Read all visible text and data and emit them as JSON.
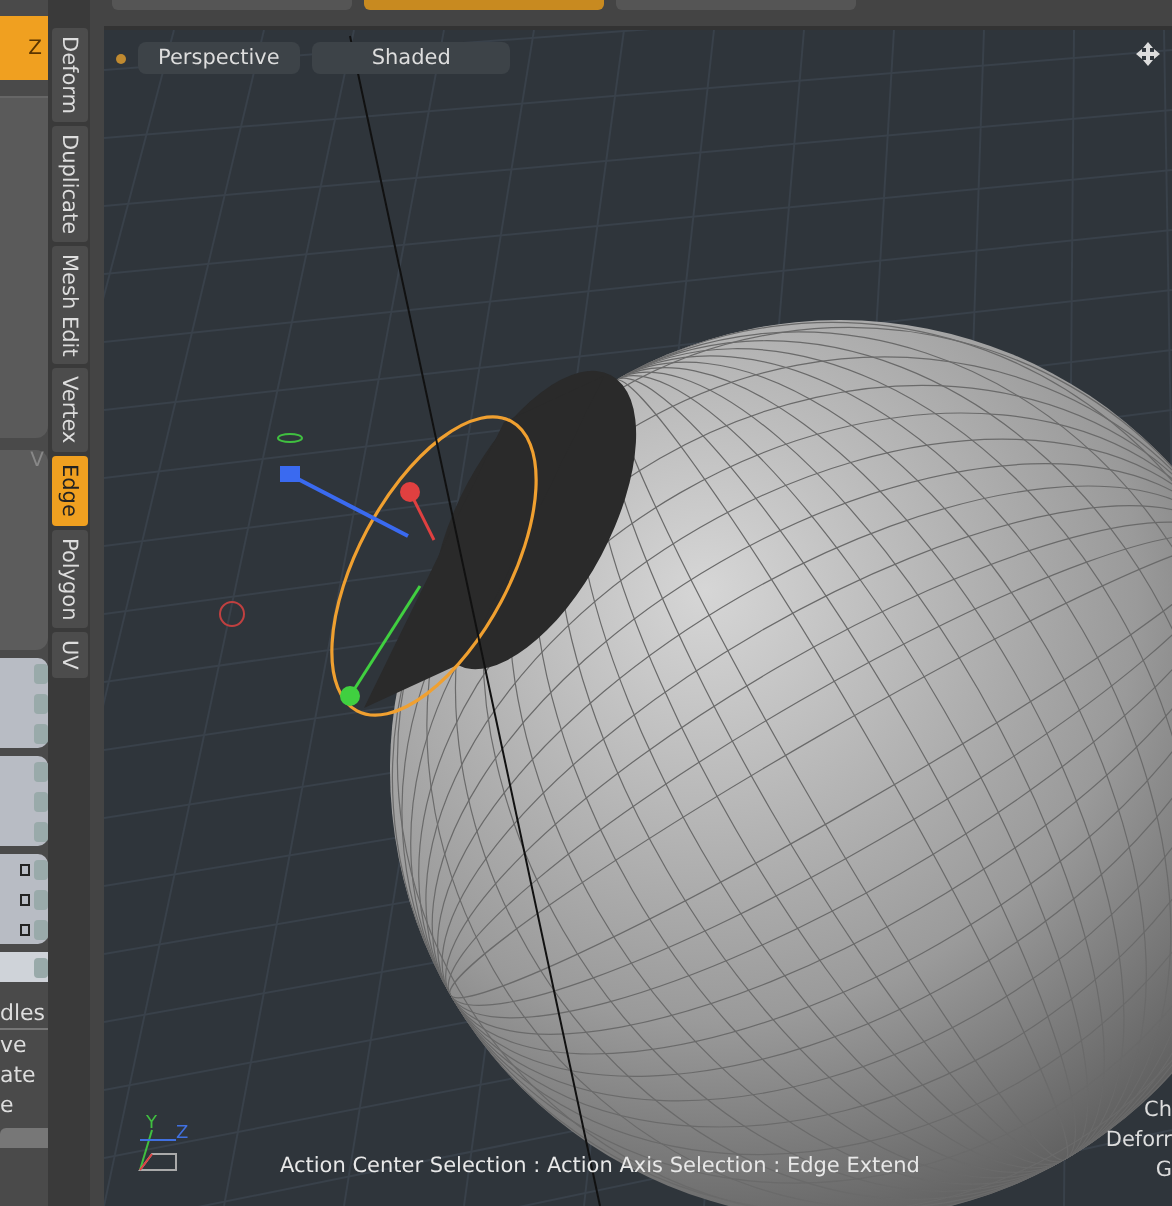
{
  "left_panel": {
    "axis_button": {
      "label": "Z",
      "selected": true
    },
    "field_label": "V",
    "spinner_groups": [
      {
        "rows": [
          {
            "kind": "plain"
          },
          {
            "kind": "plain"
          },
          {
            "kind": "plain"
          }
        ]
      },
      {
        "rows": [
          {
            "kind": "plain"
          },
          {
            "kind": "plain"
          },
          {
            "kind": "plain"
          }
        ]
      },
      {
        "rows": [
          {
            "kind": "keyed"
          },
          {
            "kind": "keyed"
          },
          {
            "kind": "keyed"
          }
        ]
      },
      {
        "rows": [
          {
            "kind": "slider"
          }
        ]
      }
    ],
    "section_title": "dles",
    "items": [
      "ve",
      "ate",
      "e"
    ]
  },
  "tabs": [
    {
      "label": "Deform",
      "selected": false
    },
    {
      "label": "Duplicate",
      "selected": false
    },
    {
      "label": "Mesh Edit",
      "selected": false
    },
    {
      "label": "Vertex",
      "selected": false
    },
    {
      "label": "Edge",
      "selected": true
    },
    {
      "label": "Polygon",
      "selected": false
    },
    {
      "label": "UV",
      "selected": false
    }
  ],
  "viewport": {
    "view_label": "Perspective",
    "shading": "Shaded",
    "status": "Action Center Selection : Action Axis Selection : Edge Extend",
    "side_info": [
      "Ch",
      "Deforr",
      "G"
    ],
    "axis_labels": [
      "Y",
      "Z"
    ]
  }
}
